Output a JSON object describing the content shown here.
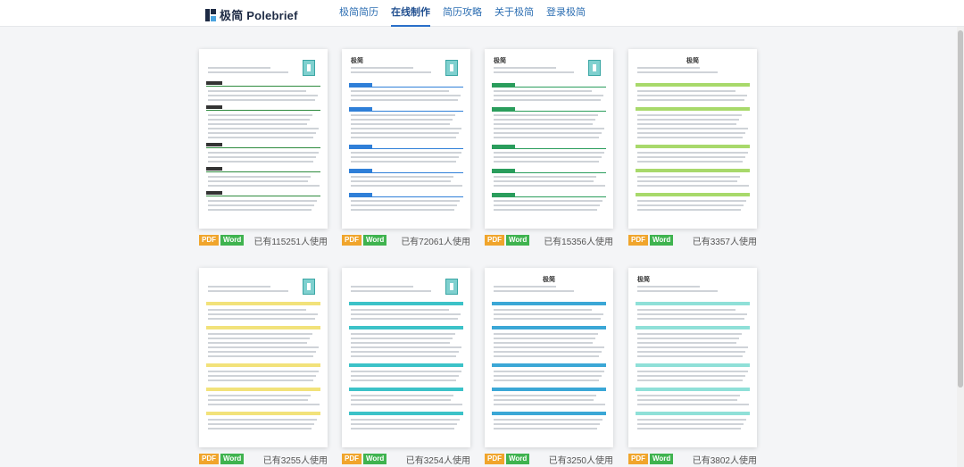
{
  "header": {
    "logo_text": "极简 Polebrief",
    "nav": [
      {
        "label": "极简简历",
        "active": false
      },
      {
        "label": "在线制作",
        "active": true
      },
      {
        "label": "简历攻略",
        "active": false
      },
      {
        "label": "关于极简",
        "active": false
      },
      {
        "label": "登录极简",
        "active": false
      }
    ]
  },
  "colors": {
    "accent": "#2a6fc9",
    "pdf_tag": "#f0a52c",
    "word_tag": "#3fb34f"
  },
  "templates": [
    {
      "pdf_label": "PDF",
      "word_label": "Word",
      "usage": "已有115251人使用",
      "accent": "#2e8b3e",
      "style": "rule",
      "center_name": false,
      "name": "",
      "photo": true
    },
    {
      "pdf_label": "PDF",
      "word_label": "Word",
      "usage": "已有72061人使用",
      "accent": "#2f7fd8",
      "style": "tab",
      "center_name": false,
      "name": "极简",
      "photo": true
    },
    {
      "pdf_label": "PDF",
      "word_label": "Word",
      "usage": "已有15356人使用",
      "accent": "#2a9d5c",
      "style": "tab",
      "center_name": false,
      "name": "极简",
      "photo": true
    },
    {
      "pdf_label": "PDF",
      "word_label": "Word",
      "usage": "已有3357人使用",
      "accent": "#a8d96b",
      "style": "band",
      "center_name": true,
      "name": "极简",
      "photo": false
    },
    {
      "pdf_label": "PDF",
      "word_label": "Word",
      "usage": "已有3255人使用",
      "accent": "#f2e27a",
      "style": "band",
      "center_name": false,
      "name": "",
      "photo": true
    },
    {
      "pdf_label": "PDF",
      "word_label": "Word",
      "usage": "已有3254人使用",
      "accent": "#3cc2c8",
      "style": "band",
      "center_name": false,
      "name": "",
      "photo": true
    },
    {
      "pdf_label": "PDF",
      "word_label": "Word",
      "usage": "已有3250人使用",
      "accent": "#3ba7d6",
      "style": "band",
      "center_name": true,
      "name": "极简",
      "photo": false
    },
    {
      "pdf_label": "PDF",
      "word_label": "Word",
      "usage": "已有3802人使用",
      "accent": "#8fe0d8",
      "style": "band",
      "center_name": false,
      "name": "极简",
      "photo": false
    }
  ]
}
